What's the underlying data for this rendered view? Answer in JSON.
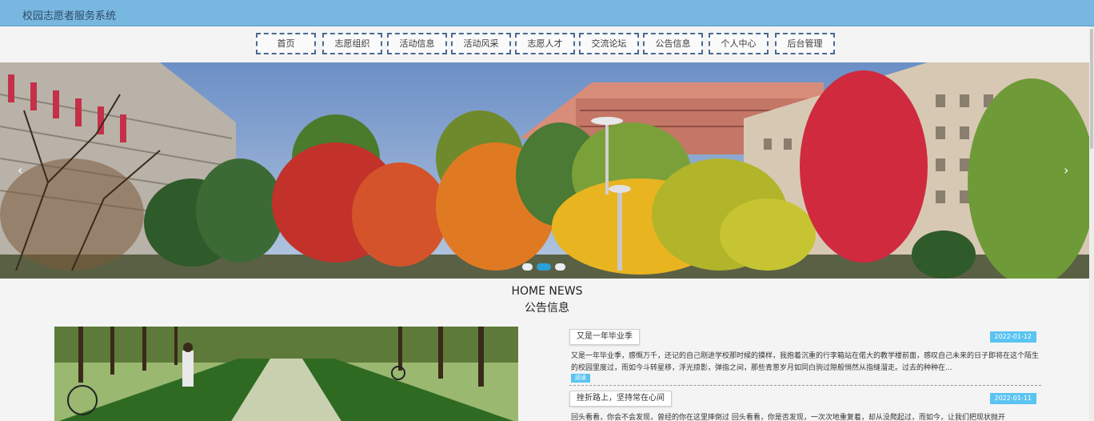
{
  "app": {
    "title": "校园志愿者服务系统"
  },
  "nav": [
    {
      "label": "首页"
    },
    {
      "label": "志愿组织"
    },
    {
      "label": "活动信息"
    },
    {
      "label": "活动风采"
    },
    {
      "label": "志愿人才"
    },
    {
      "label": "交流论坛"
    },
    {
      "label": "公告信息"
    },
    {
      "label": "个人中心"
    },
    {
      "label": "后台管理"
    }
  ],
  "banner": {
    "prev_icon": "chevron-left-icon",
    "next_icon": "chevron-right-icon",
    "prev_glyph": "‹",
    "next_glyph": "›",
    "slides": 3,
    "active_slide": 2
  },
  "section": {
    "title_en": "HOME NEWS",
    "title_cn": "公告信息"
  },
  "news": [
    {
      "title": "又是一年毕业季",
      "date": "2022-01-12",
      "desc": "又是一年毕业季，感慨万千，还记的自己刚进学校那时候的摸样，我抱着沉重的行李箱站在偌大的教学楼前面，感叹自己未来的日子即将在这个陌生的校园里度过，而如今斗转星移，浮光掠影，弹指之间，那些青葱岁月如同白驹过隙般悄然从指缝溜走。过去的种种在...",
      "more": "阅读"
    },
    {
      "title": "挫折路上，坚持常在心间",
      "date": "2022-01-11",
      "desc": "回头看看，你会不会发现，曾经的你在这里摔倒过 回头看看，你是否发现，一次次地重复着，却从没爬起过，而如今，让我们把现状抛开"
    }
  ],
  "colors": {
    "accent": "#5bc4f0",
    "topbar": "#78b8e0",
    "nav_border": "#4a6a90"
  }
}
